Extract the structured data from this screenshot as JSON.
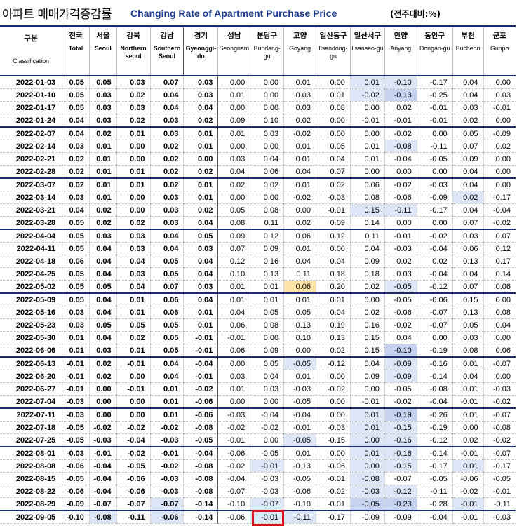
{
  "title": {
    "korean": "아파트 매매가격증감률",
    "english": "Changing Rate of Apartment Purchase Price",
    "unit": "(전주대비:%)"
  },
  "columns": [
    {
      "ko": "구분",
      "en": "Classification",
      "bold": false
    },
    {
      "ko": "전국",
      "en": "Total",
      "bold": true
    },
    {
      "ko": "서울",
      "en": "Seoul",
      "bold": true
    },
    {
      "ko": "강북",
      "en": "Northern seoul",
      "bold": true
    },
    {
      "ko": "강남",
      "en": "Southern Seoul",
      "bold": true
    },
    {
      "ko": "경기",
      "en": "Gyeonggi-do",
      "bold": true
    },
    {
      "ko": "성남",
      "en": "Seongnam",
      "bold": false
    },
    {
      "ko": "분당구",
      "en": "Bundang-gu",
      "bold": false
    },
    {
      "ko": "고양",
      "en": "Goyang",
      "bold": false
    },
    {
      "ko": "일산동구",
      "en": "Ilsandong-gu",
      "bold": false
    },
    {
      "ko": "일산서구",
      "en": "Ilsanseo-gu",
      "bold": false
    },
    {
      "ko": "안양",
      "en": "Anyang",
      "bold": false
    },
    {
      "ko": "동안구",
      "en": "Dongan-gu",
      "bold": false
    },
    {
      "ko": "부천",
      "en": "Bucheon",
      "bold": false
    },
    {
      "ko": "군포",
      "en": "Gunpo",
      "bold": false
    }
  ],
  "rows": [
    {
      "date": "2022-01-03",
      "v": [
        "0.05",
        "0.05",
        "0.03",
        "0.07",
        "0.03",
        "0.00",
        "0.00",
        "0.01",
        "0.00",
        "0.01",
        "-0.10",
        "-0.17",
        "0.04",
        "0.00"
      ]
    },
    {
      "date": "2022-01-10",
      "v": [
        "0.05",
        "0.03",
        "0.02",
        "0.04",
        "0.03",
        "0.01",
        "0.00",
        "0.03",
        "0.01",
        "-0.02",
        "-0.13",
        "-0.25",
        "0.04",
        "0.03"
      ]
    },
    {
      "date": "2022-01-17",
      "v": [
        "0.05",
        "0.03",
        "0.03",
        "0.04",
        "0.04",
        "0.00",
        "0.00",
        "0.03",
        "0.08",
        "0.00",
        "0.02",
        "-0.01",
        "0.03",
        "-0.01"
      ]
    },
    {
      "date": "2022-01-24",
      "v": [
        "0.04",
        "0.03",
        "0.02",
        "0.03",
        "0.02",
        "0.09",
        "0.10",
        "0.02",
        "0.00",
        "-0.01",
        "-0.01",
        "-0.01",
        "0.02",
        "0.00"
      ]
    },
    {
      "date": "2022-02-07",
      "v": [
        "0.04",
        "0.02",
        "0.01",
        "0.03",
        "0.01",
        "0.01",
        "0.03",
        "-0.02",
        "0.00",
        "0.00",
        "-0.02",
        "0.00",
        "0.05",
        "-0.09"
      ]
    },
    {
      "date": "2022-02-14",
      "v": [
        "0.03",
        "0.01",
        "0.00",
        "0.02",
        "0.01",
        "0.00",
        "0.00",
        "0.01",
        "0.05",
        "0.01",
        "-0.08",
        "-0.11",
        "0.07",
        "0.02"
      ]
    },
    {
      "date": "2022-02-21",
      "v": [
        "0.02",
        "0.01",
        "0.00",
        "0.02",
        "0.00",
        "0.03",
        "0.04",
        "0.01",
        "0.04",
        "0.01",
        "-0.04",
        "-0.05",
        "0.09",
        "0.00"
      ]
    },
    {
      "date": "2022-02-28",
      "v": [
        "0.02",
        "0.01",
        "0.01",
        "0.02",
        "0.02",
        "0.04",
        "0.06",
        "0.04",
        "0.07",
        "0.00",
        "0.00",
        "0.00",
        "0.04",
        "0.00"
      ]
    },
    {
      "date": "2022-03-07",
      "v": [
        "0.02",
        "0.01",
        "0.01",
        "0.02",
        "0.01",
        "0.02",
        "0.02",
        "0.01",
        "0.02",
        "0.06",
        "-0.02",
        "-0.03",
        "0.04",
        "0.00"
      ]
    },
    {
      "date": "2022-03-14",
      "v": [
        "0.03",
        "0.01",
        "0.00",
        "0.03",
        "0.01",
        "0.00",
        "0.00",
        "-0.02",
        "-0.03",
        "0.08",
        "-0.06",
        "-0.09",
        "0.02",
        "-0.17"
      ]
    },
    {
      "date": "2022-03-21",
      "v": [
        "0.04",
        "0.02",
        "0.00",
        "0.03",
        "0.02",
        "0.05",
        "0.08",
        "0.00",
        "-0.01",
        "0.15",
        "-0.11",
        "-0.17",
        "0.04",
        "-0.04"
      ]
    },
    {
      "date": "2022-03-28",
      "v": [
        "0.05",
        "0.02",
        "0.02",
        "0.03",
        "0.04",
        "0.08",
        "0.11",
        "0.02",
        "0.09",
        "0.14",
        "0.00",
        "0.00",
        "0.07",
        "-0.02"
      ]
    },
    {
      "date": "2022-04-04",
      "v": [
        "0.05",
        "0.03",
        "0.03",
        "0.04",
        "0.05",
        "0.09",
        "0.12",
        "0.06",
        "0.12",
        "0.11",
        "-0.01",
        "-0.02",
        "0.03",
        "0.07"
      ]
    },
    {
      "date": "2022-04-11",
      "v": [
        "0.05",
        "0.04",
        "0.03",
        "0.04",
        "0.03",
        "0.07",
        "0.09",
        "0.01",
        "0.00",
        "0.04",
        "-0.03",
        "-0.04",
        "0.06",
        "0.12"
      ]
    },
    {
      "date": "2022-04-18",
      "v": [
        "0.06",
        "0.04",
        "0.04",
        "0.05",
        "0.04",
        "0.12",
        "0.16",
        "0.04",
        "0.04",
        "0.09",
        "0.02",
        "0.02",
        "0.13",
        "0.17"
      ]
    },
    {
      "date": "2022-04-25",
      "v": [
        "0.05",
        "0.04",
        "0.03",
        "0.05",
        "0.04",
        "0.10",
        "0.13",
        "0.11",
        "0.18",
        "0.18",
        "0.03",
        "-0.04",
        "0.04",
        "0.14"
      ]
    },
    {
      "date": "2022-05-02",
      "v": [
        "0.05",
        "0.05",
        "0.04",
        "0.07",
        "0.03",
        "0.01",
        "0.01",
        "0.06",
        "0.20",
        "0.02",
        "-0.05",
        "-0.12",
        "0.07",
        "0.06"
      ]
    },
    {
      "date": "2022-05-09",
      "v": [
        "0.05",
        "0.04",
        "0.01",
        "0.06",
        "0.04",
        "0.01",
        "0.01",
        "0.01",
        "0.01",
        "0.00",
        "-0.05",
        "-0.06",
        "0.15",
        "0.00"
      ]
    },
    {
      "date": "2022-05-16",
      "v": [
        "0.03",
        "0.04",
        "0.01",
        "0.06",
        "0.01",
        "0.04",
        "0.05",
        "0.05",
        "0.04",
        "0.02",
        "-0.06",
        "-0.07",
        "0.13",
        "0.08"
      ]
    },
    {
      "date": "2022-05-23",
      "v": [
        "0.03",
        "0.05",
        "0.05",
        "0.05",
        "0.01",
        "0.06",
        "0.08",
        "0.13",
        "0.19",
        "0.16",
        "-0.02",
        "-0.07",
        "0.05",
        "0.04"
      ]
    },
    {
      "date": "2022-05-30",
      "v": [
        "0.01",
        "0.04",
        "0.02",
        "0.05",
        "-0.01",
        "-0.01",
        "0.00",
        "0.10",
        "0.13",
        "0.15",
        "0.04",
        "0.00",
        "0.03",
        "0.00"
      ]
    },
    {
      "date": "2022-06-06",
      "v": [
        "0.01",
        "0.03",
        "0.01",
        "0.05",
        "-0.01",
        "0.06",
        "0.09",
        "0.00",
        "0.02",
        "0.15",
        "-0.10",
        "-0.19",
        "0.08",
        "0.06"
      ]
    },
    {
      "date": "2022-06-13",
      "v": [
        "-0.01",
        "0.02",
        "-0.01",
        "0.04",
        "-0.04",
        "0.00",
        "0.05",
        "-0.05",
        "-0.12",
        "0.04",
        "-0.09",
        "-0.16",
        "0.01",
        "-0.07"
      ]
    },
    {
      "date": "2022-06-20",
      "v": [
        "-0.01",
        "0.02",
        "0.00",
        "0.04",
        "-0.01",
        "0.03",
        "0.04",
        "0.01",
        "0.00",
        "0.09",
        "-0.09",
        "-0.14",
        "0.04",
        "0.00"
      ]
    },
    {
      "date": "2022-06-27",
      "v": [
        "-0.01",
        "0.00",
        "-0.01",
        "0.01",
        "-0.02",
        "0.01",
        "0.03",
        "-0.03",
        "-0.02",
        "0.00",
        "-0.05",
        "-0.08",
        "0.01",
        "-0.03"
      ]
    },
    {
      "date": "2022-07-04",
      "v": [
        "-0.03",
        "0.00",
        "0.00",
        "0.01",
        "-0.06",
        "0.00",
        "0.00",
        "-0.05",
        "0.00",
        "-0.01",
        "-0.02",
        "-0.04",
        "-0.01",
        "-0.02"
      ]
    },
    {
      "date": "2022-07-11",
      "v": [
        "-0.03",
        "0.00",
        "0.00",
        "0.01",
        "-0.06",
        "-0.03",
        "-0.04",
        "-0.04",
        "0.00",
        "0.01",
        "-0.19",
        "-0.26",
        "0.01",
        "-0.07"
      ]
    },
    {
      "date": "2022-07-18",
      "v": [
        "-0.05",
        "-0.02",
        "-0.02",
        "-0.02",
        "-0.08",
        "-0.02",
        "-0.02",
        "-0.01",
        "-0.03",
        "0.01",
        "-0.15",
        "-0.19",
        "0.00",
        "-0.08"
      ]
    },
    {
      "date": "2022-07-25",
      "v": [
        "-0.05",
        "-0.03",
        "-0.04",
        "-0.03",
        "-0.05",
        "-0.01",
        "0.00",
        "-0.05",
        "-0.15",
        "0.00",
        "-0.16",
        "-0.12",
        "0.02",
        "-0.02"
      ]
    },
    {
      "date": "2022-08-01",
      "v": [
        "-0.03",
        "-0.01",
        "-0.02",
        "-0.01",
        "-0.04",
        "-0.06",
        "-0.05",
        "0.01",
        "0.00",
        "0.01",
        "-0.16",
        "-0.14",
        "-0.01",
        "-0.07"
      ]
    },
    {
      "date": "2022-08-08",
      "v": [
        "-0.06",
        "-0.04",
        "-0.05",
        "-0.02",
        "-0.08",
        "-0.02",
        "-0.01",
        "-0.13",
        "-0.06",
        "0.00",
        "-0.15",
        "-0.17",
        "0.01",
        "-0.17"
      ]
    },
    {
      "date": "2022-08-15",
      "v": [
        "-0.05",
        "-0.04",
        "-0.06",
        "-0.03",
        "-0.08",
        "-0.04",
        "-0.03",
        "-0.05",
        "-0.01",
        "-0.08",
        "-0.07",
        "-0.05",
        "-0.06",
        "-0.05"
      ]
    },
    {
      "date": "2022-08-22",
      "v": [
        "-0.06",
        "-0.04",
        "-0.06",
        "-0.03",
        "-0.08",
        "-0.07",
        "-0.03",
        "-0.06",
        "-0.02",
        "-0.03",
        "-0.12",
        "-0.11",
        "-0.02",
        "-0.01"
      ]
    },
    {
      "date": "2022-08-29",
      "v": [
        "-0.09",
        "-0.07",
        "-0.07",
        "-0.07",
        "-0.14",
        "-0.10",
        "-0.07",
        "-0.10",
        "-0.01",
        "-0.05",
        "-0.23",
        "-0.28",
        "-0.01",
        "-0.11"
      ]
    },
    {
      "date": "2022-09-05",
      "v": [
        "-0.10",
        "-0.08",
        "-0.11",
        "-0.06",
        "-0.14",
        "-0.06",
        "-0.01",
        "-0.11",
        "-0.17",
        "-0.09",
        "-0.09",
        "-0.04",
        "-0.01",
        "-0.03"
      ]
    }
  ],
  "highlight_light": [
    [
      0,
      10
    ],
    [
      0,
      11
    ],
    [
      1,
      10
    ],
    [
      1,
      11
    ],
    [
      5,
      11
    ],
    [
      9,
      13
    ],
    [
      10,
      10
    ],
    [
      10,
      11
    ],
    [
      16,
      11
    ],
    [
      21,
      11
    ],
    [
      22,
      8
    ],
    [
      22,
      11
    ],
    [
      23,
      11
    ],
    [
      26,
      10
    ],
    [
      26,
      11
    ],
    [
      27,
      10
    ],
    [
      27,
      11
    ],
    [
      28,
      8
    ],
    [
      28,
      10
    ],
    [
      28,
      11
    ],
    [
      29,
      10
    ],
    [
      29,
      11
    ],
    [
      30,
      7
    ],
    [
      30,
      10
    ],
    [
      30,
      11
    ],
    [
      30,
      13
    ],
    [
      31,
      10
    ],
    [
      32,
      10
    ],
    [
      32,
      11
    ],
    [
      33,
      4
    ],
    [
      33,
      7
    ],
    [
      33,
      10
    ],
    [
      33,
      11
    ],
    [
      33,
      13
    ],
    [
      34,
      2
    ],
    [
      34,
      4
    ],
    [
      34,
      7
    ],
    [
      34,
      8
    ]
  ],
  "highlight_strong": [
    [
      1,
      11
    ],
    [
      21,
      11
    ],
    [
      26,
      11
    ],
    [
      33,
      10
    ],
    [
      33,
      11
    ]
  ],
  "highlight_orange": [
    [
      16,
      8
    ]
  ],
  "red_box_cell": [
    34,
    6
  ],
  "bold_columns": [
    0,
    1,
    2,
    3,
    4
  ],
  "separator_after_col": 4,
  "month_break_rows": [
    4,
    8,
    12,
    17,
    22,
    26,
    29,
    34
  ]
}
